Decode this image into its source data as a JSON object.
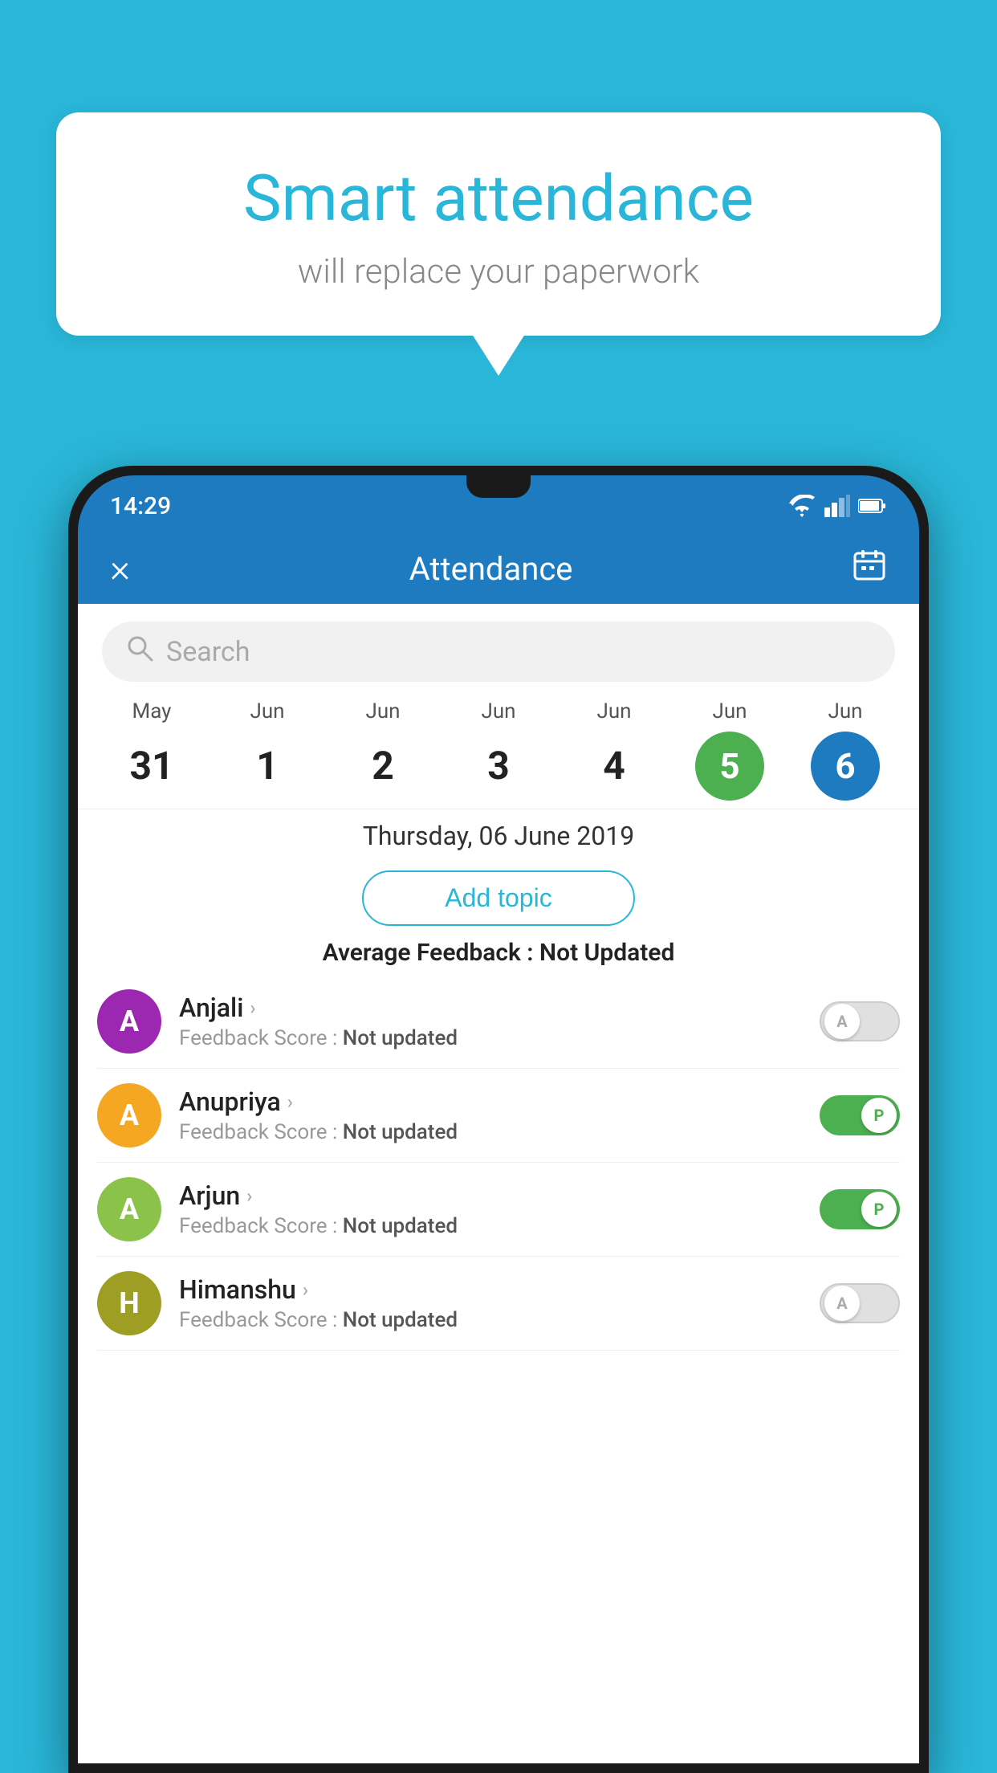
{
  "background_color": "#29b6d8",
  "bubble": {
    "title": "Smart attendance",
    "subtitle": "will replace your paperwork"
  },
  "status_bar": {
    "time": "14:29",
    "wifi_icon": "wifi",
    "signal_icon": "signal",
    "battery_icon": "battery"
  },
  "header": {
    "close_label": "×",
    "title": "Attendance",
    "calendar_icon": "calendar"
  },
  "search": {
    "placeholder": "Search"
  },
  "calendar": {
    "dates": [
      {
        "month": "May",
        "day": "31",
        "selected": ""
      },
      {
        "month": "Jun",
        "day": "1",
        "selected": ""
      },
      {
        "month": "Jun",
        "day": "2",
        "selected": ""
      },
      {
        "month": "Jun",
        "day": "3",
        "selected": ""
      },
      {
        "month": "Jun",
        "day": "4",
        "selected": ""
      },
      {
        "month": "Jun",
        "day": "5",
        "selected": "green"
      },
      {
        "month": "Jun",
        "day": "6",
        "selected": "blue"
      }
    ],
    "selected_date_label": "Thursday, 06 June 2019"
  },
  "add_topic_label": "Add topic",
  "avg_feedback": {
    "label": "Average Feedback :",
    "value": "Not Updated"
  },
  "students": [
    {
      "name": "Anjali",
      "avatar_letter": "A",
      "avatar_color": "#9c27b0",
      "feedback_label": "Feedback Score :",
      "feedback_value": "Not updated",
      "toggle": "off",
      "toggle_letter": "A"
    },
    {
      "name": "Anupriya",
      "avatar_letter": "A",
      "avatar_color": "#f5a623",
      "feedback_label": "Feedback Score :",
      "feedback_value": "Not updated",
      "toggle": "on",
      "toggle_letter": "P"
    },
    {
      "name": "Arjun",
      "avatar_letter": "A",
      "avatar_color": "#8bc34a",
      "feedback_label": "Feedback Score :",
      "feedback_value": "Not updated",
      "toggle": "on",
      "toggle_letter": "P"
    },
    {
      "name": "Himanshu",
      "avatar_letter": "H",
      "avatar_color": "#9e9d24",
      "feedback_label": "Feedback Score :",
      "feedback_value": "Not updated",
      "toggle": "off",
      "toggle_letter": "A"
    }
  ]
}
